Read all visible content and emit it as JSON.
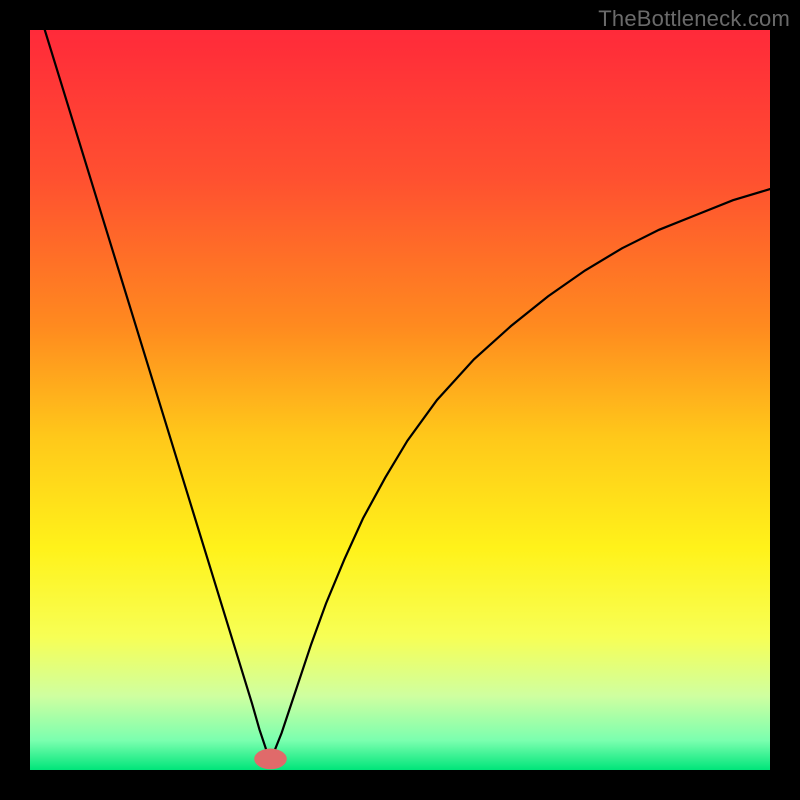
{
  "watermark": "TheBottleneck.com",
  "chart_data": {
    "type": "line",
    "title": "",
    "xlabel": "",
    "ylabel": "",
    "xlim": [
      0,
      100
    ],
    "ylim": [
      0,
      100
    ],
    "legend": false,
    "grid": false,
    "background_gradient_stops": [
      {
        "pos": 0.0,
        "color": "#ff2a3a"
      },
      {
        "pos": 0.2,
        "color": "#ff5030"
      },
      {
        "pos": 0.4,
        "color": "#ff8a1f"
      },
      {
        "pos": 0.55,
        "color": "#ffc81a"
      },
      {
        "pos": 0.7,
        "color": "#fff21a"
      },
      {
        "pos": 0.82,
        "color": "#f7ff55"
      },
      {
        "pos": 0.9,
        "color": "#cfffa0"
      },
      {
        "pos": 0.96,
        "color": "#7bffaf"
      },
      {
        "pos": 1.0,
        "color": "#00e57a"
      }
    ],
    "curve_stroke": "#000000",
    "minimum_marker": {
      "x": 32.5,
      "y": 1.5,
      "rx": 2.2,
      "ry": 1.4,
      "fill": "#e06a6a"
    },
    "series": [
      {
        "name": "curve",
        "points": [
          {
            "x": 2.0,
            "y": 100.0
          },
          {
            "x": 4.0,
            "y": 93.5
          },
          {
            "x": 6.0,
            "y": 87.0
          },
          {
            "x": 8.0,
            "y": 80.5
          },
          {
            "x": 10.0,
            "y": 74.0
          },
          {
            "x": 12.0,
            "y": 67.5
          },
          {
            "x": 14.0,
            "y": 61.0
          },
          {
            "x": 16.0,
            "y": 54.5
          },
          {
            "x": 18.0,
            "y": 48.0
          },
          {
            "x": 20.0,
            "y": 41.5
          },
          {
            "x": 22.0,
            "y": 35.0
          },
          {
            "x": 24.0,
            "y": 28.5
          },
          {
            "x": 26.0,
            "y": 22.0
          },
          {
            "x": 28.0,
            "y": 15.5
          },
          {
            "x": 30.0,
            "y": 9.0
          },
          {
            "x": 31.0,
            "y": 5.5
          },
          {
            "x": 32.0,
            "y": 2.5
          },
          {
            "x": 32.5,
            "y": 1.5
          },
          {
            "x": 33.0,
            "y": 2.5
          },
          {
            "x": 34.0,
            "y": 5.0
          },
          {
            "x": 36.0,
            "y": 11.0
          },
          {
            "x": 38.0,
            "y": 17.0
          },
          {
            "x": 40.0,
            "y": 22.5
          },
          {
            "x": 42.5,
            "y": 28.5
          },
          {
            "x": 45.0,
            "y": 34.0
          },
          {
            "x": 48.0,
            "y": 39.5
          },
          {
            "x": 51.0,
            "y": 44.5
          },
          {
            "x": 55.0,
            "y": 50.0
          },
          {
            "x": 60.0,
            "y": 55.5
          },
          {
            "x": 65.0,
            "y": 60.0
          },
          {
            "x": 70.0,
            "y": 64.0
          },
          {
            "x": 75.0,
            "y": 67.5
          },
          {
            "x": 80.0,
            "y": 70.5
          },
          {
            "x": 85.0,
            "y": 73.0
          },
          {
            "x": 90.0,
            "y": 75.0
          },
          {
            "x": 95.0,
            "y": 77.0
          },
          {
            "x": 100.0,
            "y": 78.5
          }
        ]
      }
    ]
  }
}
